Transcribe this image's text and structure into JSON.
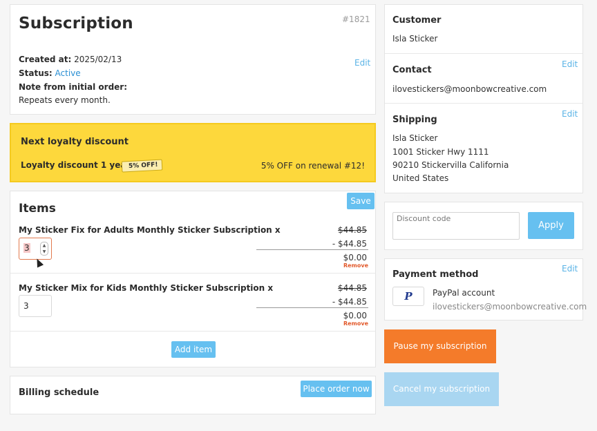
{
  "subscription": {
    "title": "Subscription",
    "order_no": "#1821",
    "created_label": "Created at:",
    "created_value": "2025/02/13",
    "status_label": "Status:",
    "status_value": "Active",
    "note_label": "Note from initial order:",
    "note_value": "Repeats every month.",
    "edit_label": "Edit"
  },
  "loyalty": {
    "heading": "Next loyalty discount",
    "name": "Loyalty discount 1 year",
    "badge": "5% OFF!",
    "renewal": "5% OFF on renewal #12!"
  },
  "items": {
    "heading": "Items",
    "save_label": "Save",
    "add_label": "Add item",
    "remove_label": "Remove",
    "list": [
      {
        "name": "My Sticker Fix for Adults Monthly Sticker Subscription x",
        "qty": "3",
        "price": "$44.85",
        "discount": "- $44.85",
        "total": "$0.00"
      },
      {
        "name": "My Sticker Mix for Kids Monthly Sticker Subscription x",
        "qty": "3",
        "price": "$44.85",
        "discount": "- $44.85",
        "total": "$0.00"
      }
    ]
  },
  "billing": {
    "heading": "Billing schedule",
    "place_order_label": "Place order now"
  },
  "customer": {
    "heading": "Customer",
    "name": "Isla Sticker"
  },
  "contact": {
    "heading": "Contact",
    "email": "ilovestickers@moonbowcreative.com",
    "edit_label": "Edit"
  },
  "shipping": {
    "heading": "Shipping",
    "edit_label": "Edit",
    "lines": [
      "Isla Sticker",
      "1001 Sticker Hwy 1111",
      "90210 Stickervilla California",
      "United States"
    ]
  },
  "discount": {
    "placeholder": "Discount code",
    "apply_label": "Apply"
  },
  "payment": {
    "heading": "Payment method",
    "edit_label": "Edit",
    "account": "PayPal account",
    "email": "ilovestickers@moonbowcreative.com"
  },
  "actions": {
    "pause_label": "Pause my subscription",
    "cancel_label": "Cancel my subscription"
  },
  "colors": {
    "accent_blue": "#66c0f0",
    "loyalty_yellow": "#fdd83c",
    "pause_orange": "#f47b2a",
    "cancel_blue": "#a9d6f1"
  }
}
